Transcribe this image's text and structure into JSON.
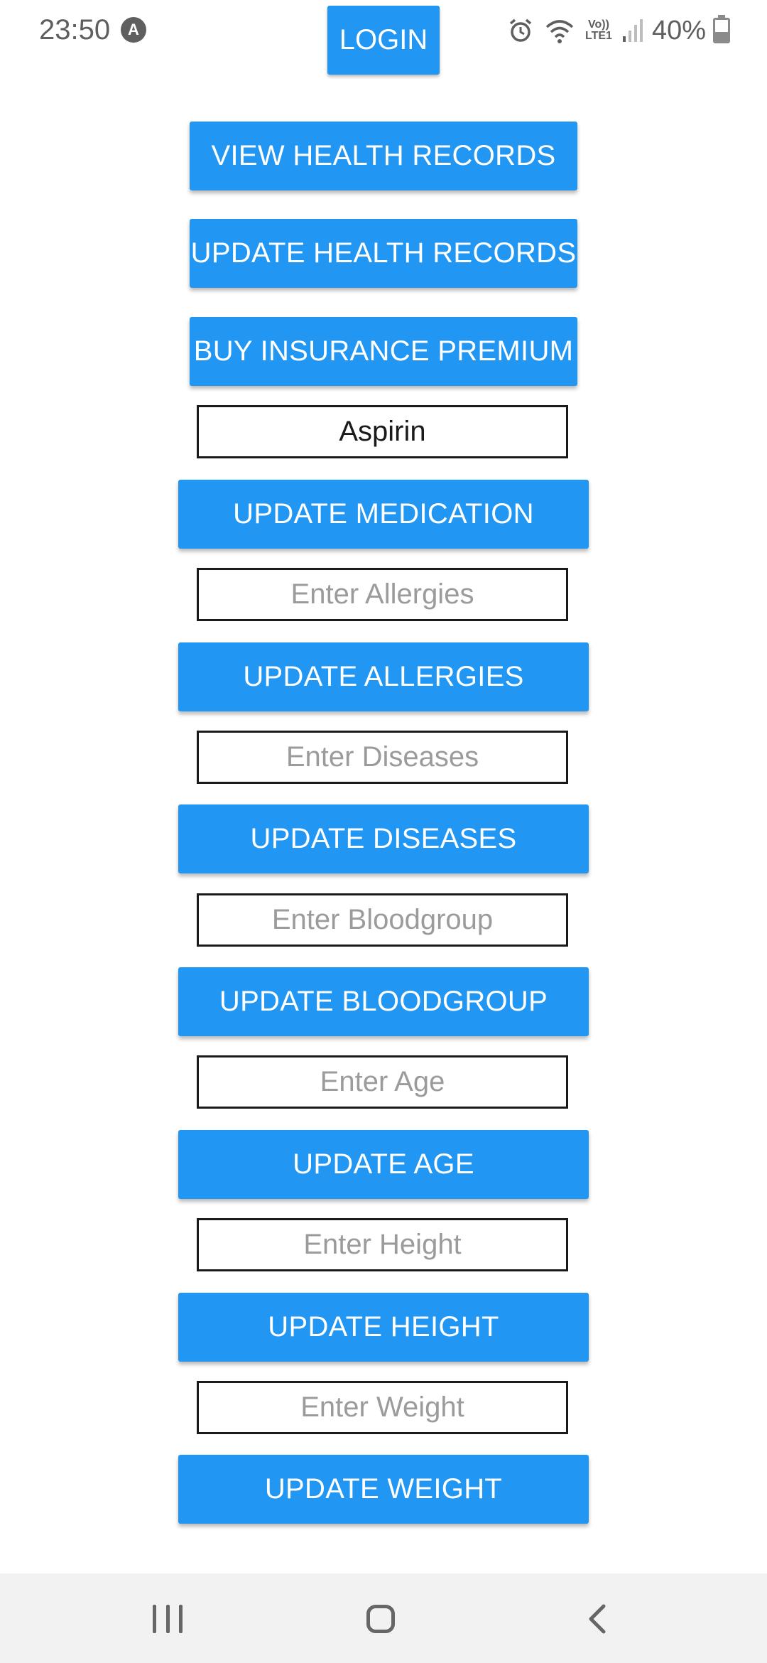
{
  "status_bar": {
    "time": "23:50",
    "app_icon": "A",
    "network": "Vo))\nLTE1",
    "battery": "40%"
  },
  "login_label": "LOGIN",
  "buttons": {
    "view_records": "VIEW HEALTH RECORDS",
    "update_records": "UPDATE HEALTH RECORDS",
    "buy_insurance": "BUY INSURANCE PREMIUM",
    "update_medication": "UPDATE MEDICATION",
    "update_allergies": "UPDATE ALLERGIES",
    "update_diseases": "UPDATE DISEASES",
    "update_bloodgroup": "UPDATE BLOODGROUP",
    "update_age": "UPDATE AGE",
    "update_height": "UPDATE HEIGHT",
    "update_weight": "UPDATE WEIGHT"
  },
  "inputs": {
    "medication": {
      "value": "Aspirin",
      "placeholder": ""
    },
    "allergies": {
      "value": "",
      "placeholder": "Enter Allergies"
    },
    "diseases": {
      "value": "",
      "placeholder": "Enter Diseases"
    },
    "bloodgroup": {
      "value": "",
      "placeholder": "Enter Bloodgroup"
    },
    "age": {
      "value": "",
      "placeholder": "Enter Age"
    },
    "height": {
      "value": "",
      "placeholder": "Enter Height"
    },
    "weight": {
      "value": "",
      "placeholder": "Enter Weight"
    }
  },
  "icons": {
    "alarm": "alarm-icon",
    "wifi": "wifi-icon",
    "signal": "signal-icon",
    "battery": "battery-icon",
    "recents": "recents-icon",
    "home": "home-icon",
    "back": "back-icon"
  },
  "colors": {
    "primary": "#2196f3",
    "nav_bar": "#f2f2f2",
    "placeholder": "#9b9b9b"
  }
}
